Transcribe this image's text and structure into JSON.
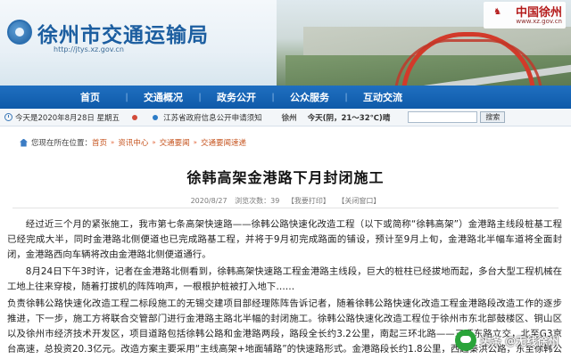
{
  "banner": {
    "site_title": "徐州市交通运输局",
    "site_url": "http://jtys.xz.gov.cn",
    "brand_name": "中国徐州",
    "brand_url": "www.xz.gov.cn"
  },
  "nav": {
    "items": [
      "首页",
      "交通概况",
      "政务公开",
      "公众服务",
      "互动交流"
    ]
  },
  "info": {
    "today_label": "今天是2020年8月28日 星期五",
    "notice_1": "江苏省政府信息公开申请须知",
    "city": "徐州",
    "weather_today": "今天(阴，21～32℃)晴",
    "search_placeholder": "",
    "search_button": "搜索"
  },
  "breadcrumb": {
    "prefix": "您现在所在位置：",
    "items": [
      "首页",
      "资讯中心",
      "交通要闻",
      "交通要闻速递"
    ]
  },
  "article": {
    "title": "徐韩高架金港路下月封闭施工",
    "meta_date": "2020/8/27",
    "meta_views": "浏览次数：39",
    "meta_print": "【我要打印】",
    "meta_close": "【关闭窗口】",
    "paragraphs": [
      "经过近三个月的紧张施工，我市第七条高架快速路——徐韩公路快速化改造工程（以下或简称“徐韩高架”）金港路主线段桩基工程已经完成大半，同时金港路北侧便道也已完成路基工程，并将于9月初完成路面的铺设，预计至9月上旬，金港路北半幅车道将全面封闭，金港路西向车辆将改由金港路北侧便道通行。",
      "8月24日下午3时许，记者在金港路北侧看到，徐韩高架快速路工程金港路主线段，巨大的桩柱已经拔地而起，多台大型工程机械在工地上往来穿梭，随着打拔机的阵阵响声，一根根护桩被打入地下……",
      "负责徐韩公路快速化改造工程二标段施工的无锡交建项目部经理陈阵告诉记者，随着徐韩公路快速化改造工程金港路段改造工作的逐步推进，下一步，施工方将联合交管部门进行金港路主路北半幅的封闭施工。徐韩公路快速化改造工程位于徐州市东北部鼓楼区、铜山区以及徐州市经济技术开发区，项目道路包括徐韩公路和金港路两段，路段全长约3.2公里，南起三环北路——三环东路立交，北至G3京台高速，总投资20.3亿元。改造方案主要采用“主线高架+地面辅路”的快速路形式。金港路段长约1.8公里，西起秦洪公路，东至徐韩公路，横跨京杭大运河，其中金港路高架桥西接秦洪立交，沿现状金港路向东，上跨现状金水路后落地。"
    ]
  },
  "watermark": {
    "text": "头条 @无线徐州"
  }
}
